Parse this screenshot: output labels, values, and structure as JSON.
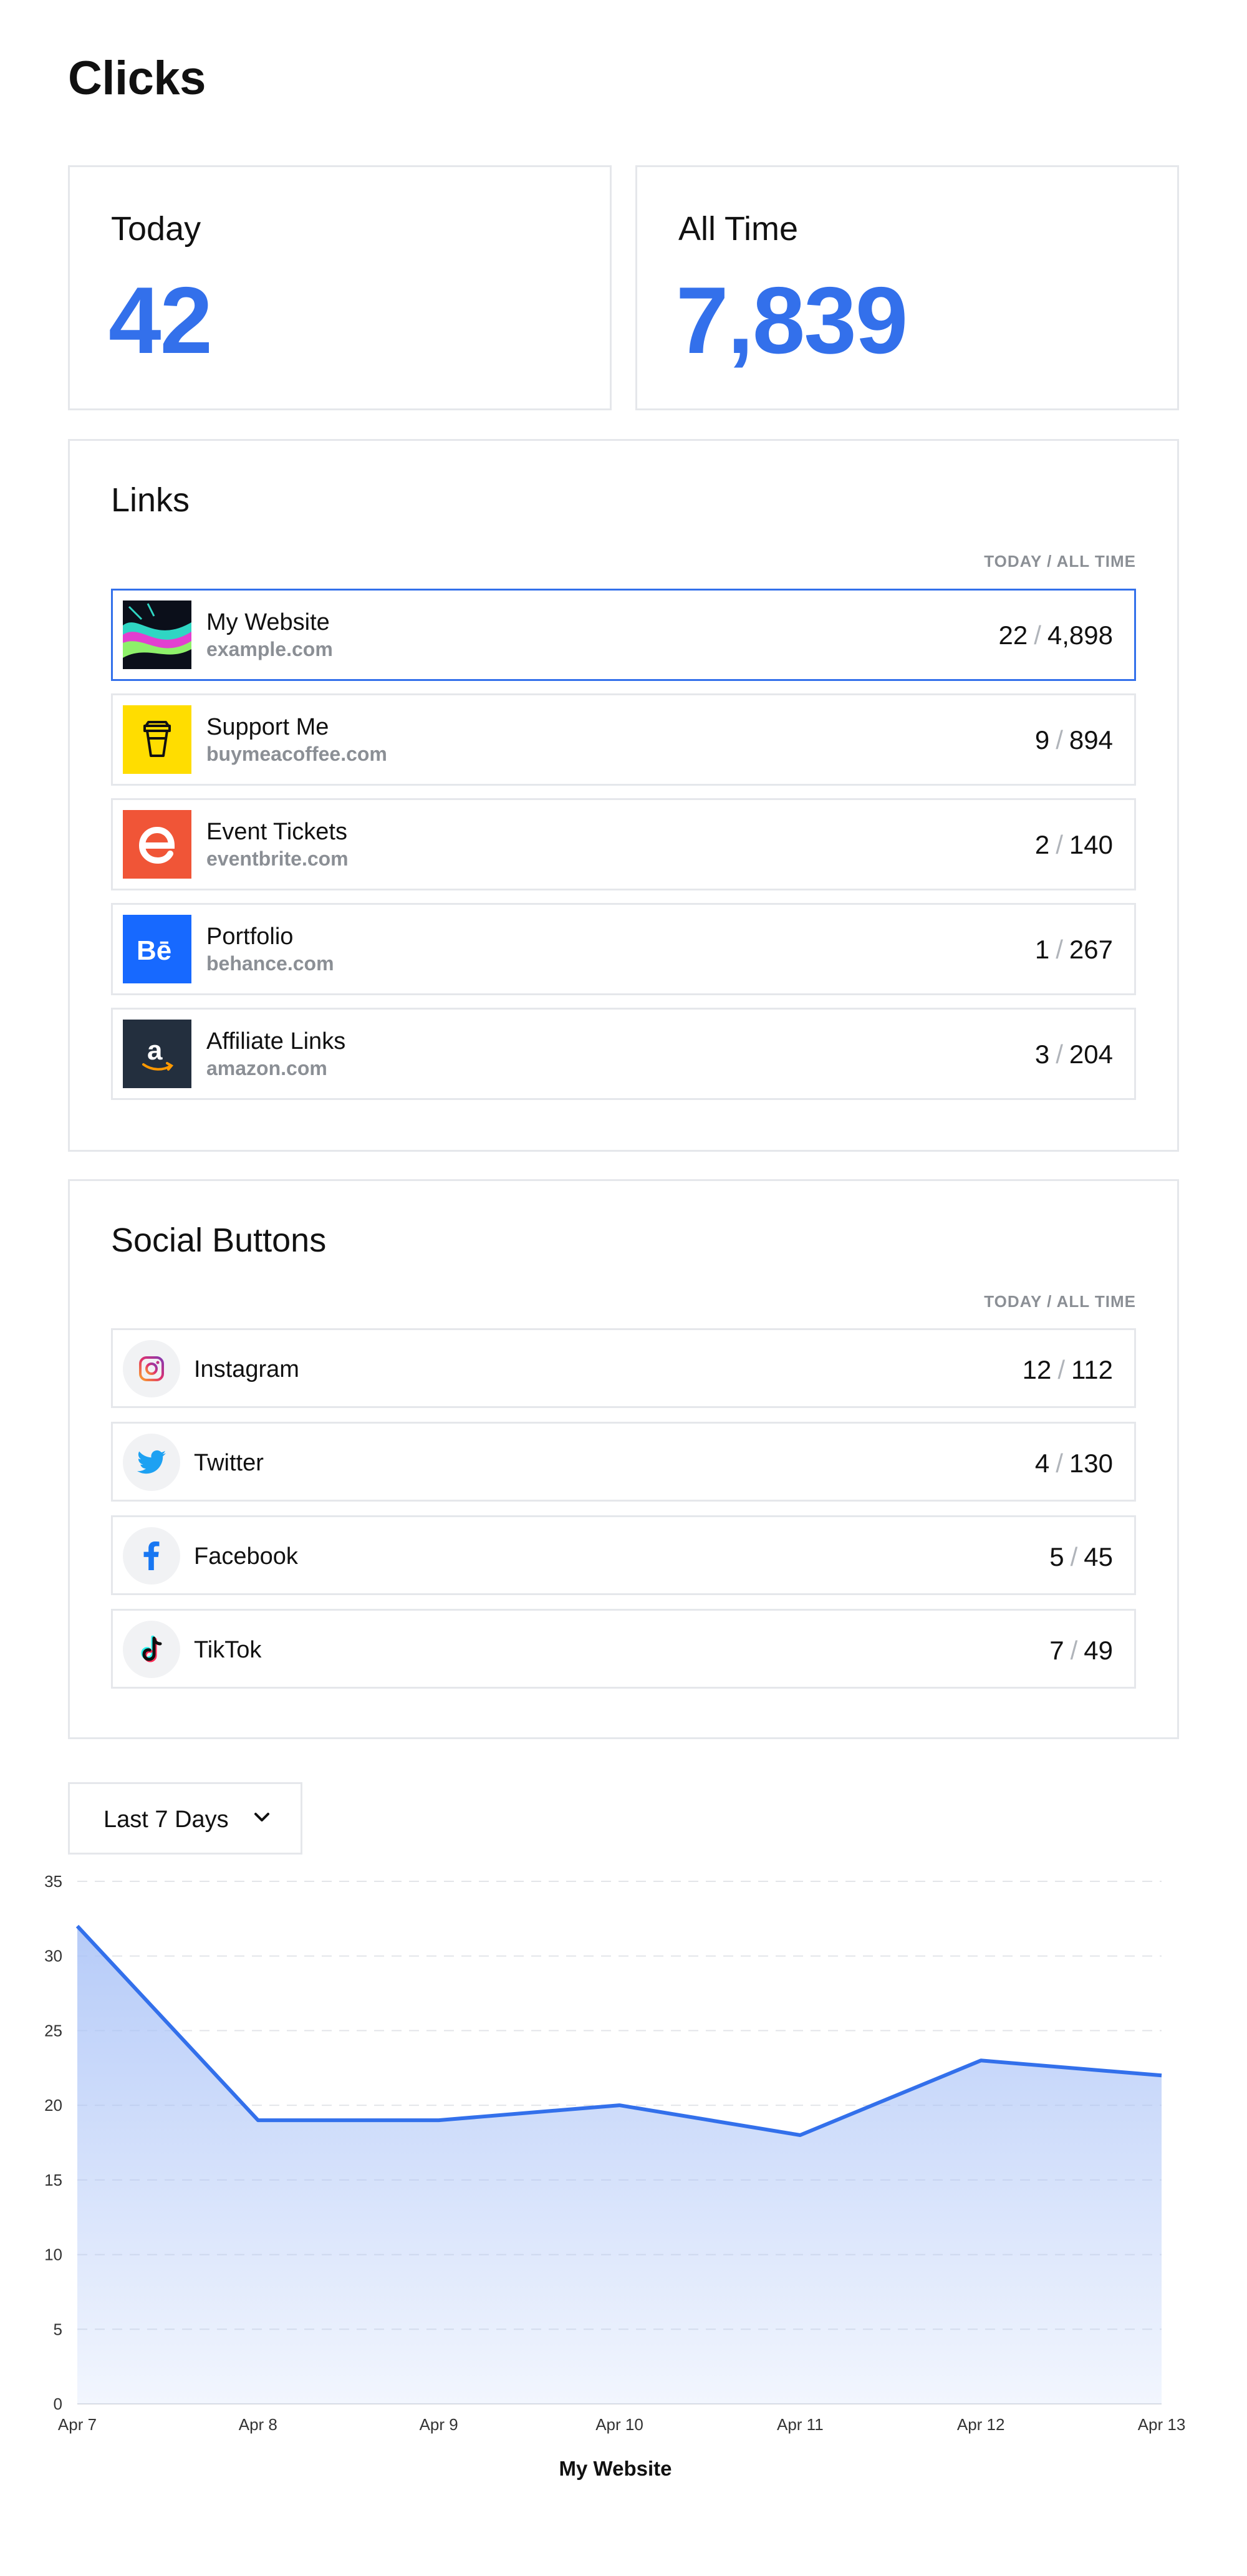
{
  "page": {
    "title": "Clicks"
  },
  "stats": {
    "today_label": "Today",
    "today_value": "42",
    "alltime_label": "All Time",
    "alltime_value": "7,839"
  },
  "links": {
    "title": "Links",
    "column_header": "TODAY / ALL TIME",
    "items": [
      {
        "title": "My Website",
        "url": "example.com",
        "today": "22",
        "all_time": "4,898",
        "icon": "abstract-wave-thumbnail"
      },
      {
        "title": "Support Me",
        "url": "buymeacoffee.com",
        "today": "9",
        "all_time": "894",
        "icon": "coffee-cup-icon",
        "color": "#ffdd00"
      },
      {
        "title": "Event Tickets",
        "url": "eventbrite.com",
        "today": "2",
        "all_time": "140",
        "icon": "eventbrite-icon",
        "color": "#f05537"
      },
      {
        "title": "Portfolio",
        "url": "behance.com",
        "today": "1",
        "all_time": "267",
        "icon": "behance-icon",
        "color": "#1769ff"
      },
      {
        "title": "Affiliate Links",
        "url": "amazon.com",
        "today": "3",
        "all_time": "204",
        "icon": "amazon-icon",
        "color": "#232f3e"
      }
    ],
    "separator": "/"
  },
  "social": {
    "title": "Social Buttons",
    "column_header": "TODAY / ALL TIME",
    "items": [
      {
        "label": "Instagram",
        "today": "12",
        "all_time": "112",
        "icon": "instagram-icon"
      },
      {
        "label": "Twitter",
        "today": "4",
        "all_time": "130",
        "icon": "twitter-icon",
        "color": "#1da1f2"
      },
      {
        "label": "Facebook",
        "today": "5",
        "all_time": "45",
        "icon": "facebook-icon",
        "color": "#1877f2"
      },
      {
        "label": "TikTok",
        "today": "7",
        "all_time": "49",
        "icon": "tiktok-icon"
      }
    ]
  },
  "range_select": {
    "value": "Last 7 Days",
    "icon": "chevron-down-icon"
  },
  "chart_data": {
    "type": "area",
    "x": [
      "Apr 7",
      "Apr 8",
      "Apr 9",
      "Apr 10",
      "Apr 11",
      "Apr 12",
      "Apr 13"
    ],
    "series": [
      {
        "values": [
          32,
          19,
          19,
          20,
          18,
          23,
          22
        ]
      }
    ],
    "xlabel": "My Website",
    "ylabel": "",
    "ylim": [
      0,
      35
    ],
    "yticks": [
      "0",
      "5",
      "10",
      "15",
      "20",
      "25",
      "30",
      "35"
    ],
    "grid": true,
    "line_color": "#3370eb",
    "fill_color": "#a9c2f7"
  }
}
